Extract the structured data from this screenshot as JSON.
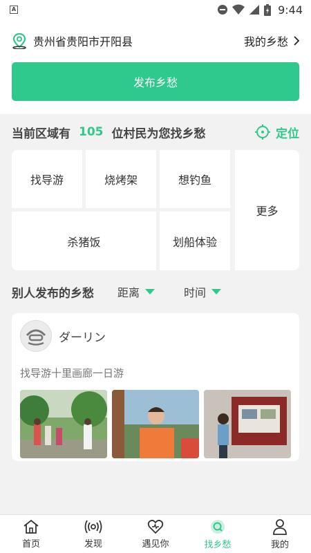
{
  "statusbar": {
    "time": "9:44"
  },
  "location": {
    "text": "贵州省贵阳市开阳县",
    "my_homesick": "我的乡愁"
  },
  "publish_button": "发布乡愁",
  "region": {
    "prefix": "当前区域有",
    "count": "105",
    "suffix": "位村民为您找乡愁",
    "locate": "定位"
  },
  "tags": [
    "找导游",
    "烧烤架",
    "想钓鱼",
    "更多",
    "杀猪饭",
    "划船体验"
  ],
  "others": {
    "title": "别人发布的乡愁",
    "sort_distance": "距离",
    "sort_time": "时间"
  },
  "post": {
    "username": "ダーリン",
    "description": "找导游十里画廊一日游"
  },
  "tabbar": [
    "首页",
    "发现",
    "遇见你",
    "找乡愁",
    "我的"
  ],
  "colors": {
    "accent": "#2ec98b"
  },
  "icons": [
    "location-pin-icon",
    "chevron-right-icon",
    "locate-crosshair-icon",
    "home-icon",
    "broadcast-icon",
    "heart-icon",
    "search-circle-icon",
    "user-icon"
  ]
}
